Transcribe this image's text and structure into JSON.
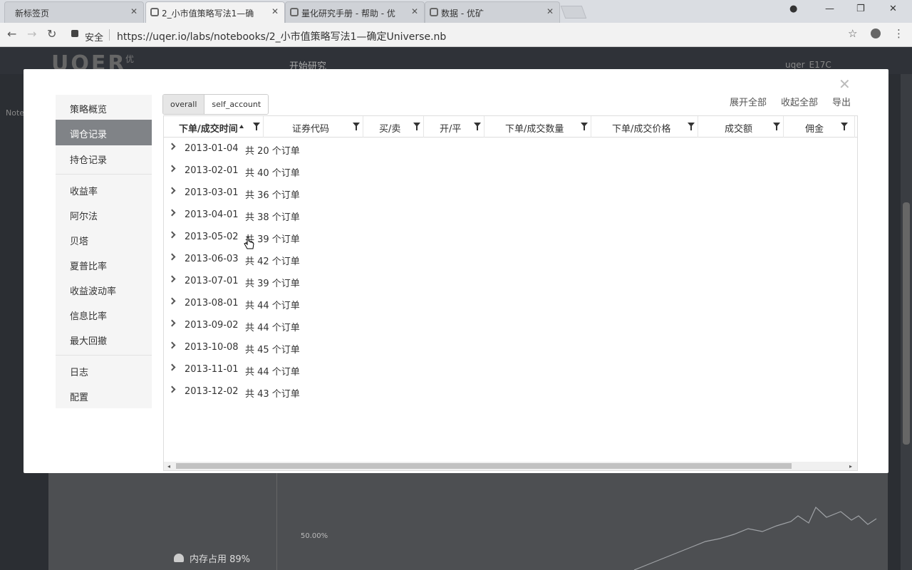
{
  "browser": {
    "tabs": [
      {
        "title": "新标签页"
      },
      {
        "title": "2_小市值策略写法1—确"
      },
      {
        "title": "量化研究手册 - 帮助 - 优"
      },
      {
        "title": "数据 - 优矿"
      }
    ],
    "secure_label": "安全",
    "url": "https://uqer.io/labs/notebooks/2_小市值策略写法1—确定Universe.nb"
  },
  "app": {
    "brand": "UQER",
    "brand_sub": "优",
    "nav": [
      "开始研究"
    ],
    "user": "uqer_E17C",
    "rail_label": "Note",
    "memory": "内存占用 89%",
    "bg_axis_label": "50.00%"
  },
  "modal": {
    "side_menu": {
      "group1": [
        "策略概览",
        "调仓记录",
        "持仓记录"
      ],
      "group2": [
        "收益率",
        "阿尔法",
        "贝塔",
        "夏普比率",
        "收益波动率",
        "信息比率",
        "最大回撤"
      ],
      "group3": [
        "日志",
        "配置"
      ],
      "active": "调仓记录"
    },
    "accounts": [
      "overall",
      "self_account"
    ],
    "active_account": "overall",
    "actions": {
      "expand_all": "展开全部",
      "collapse_all": "收起全部",
      "export": "导出"
    },
    "columns": [
      "下单/成交时间",
      "证券代码",
      "买/卖",
      "开/平",
      "下单/成交数量",
      "下单/成交价格",
      "成交额",
      "佣金"
    ],
    "rows": [
      {
        "date": "2013-01-04",
        "summary": "共 20 个订单"
      },
      {
        "date": "2013-02-01",
        "summary": "共 40 个订单"
      },
      {
        "date": "2013-03-01",
        "summary": "共 36 个订单"
      },
      {
        "date": "2013-04-01",
        "summary": "共 38 个订单"
      },
      {
        "date": "2013-05-02",
        "summary": "共 39 个订单"
      },
      {
        "date": "2013-06-03",
        "summary": "共 42 个订单"
      },
      {
        "date": "2013-07-01",
        "summary": "共 39 个订单"
      },
      {
        "date": "2013-08-01",
        "summary": "共 44 个订单"
      },
      {
        "date": "2013-09-02",
        "summary": "共 44 个订单"
      },
      {
        "date": "2013-10-08",
        "summary": "共 45 个订单"
      },
      {
        "date": "2013-11-01",
        "summary": "共 44 个订单"
      },
      {
        "date": "2013-12-02",
        "summary": "共 43 个订单"
      }
    ]
  }
}
